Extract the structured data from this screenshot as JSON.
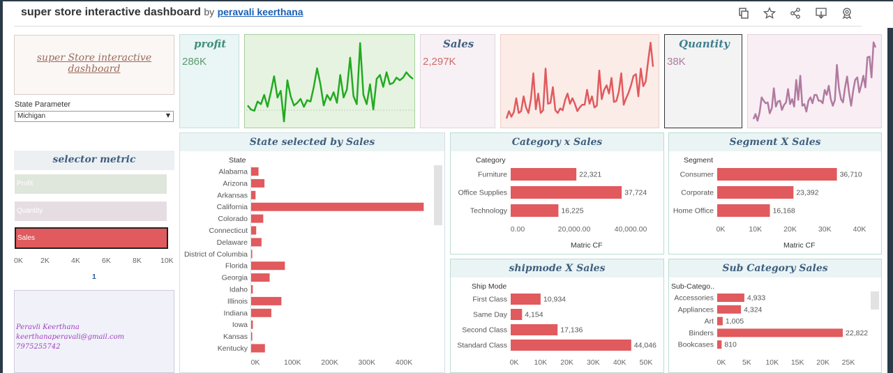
{
  "header": {
    "title": "super store interactive dashboard",
    "by": "by",
    "author": "peravali keerthana",
    "icons": [
      "revert-icon",
      "favorite-star-icon",
      "share-icon",
      "download-icon",
      "badge-icon"
    ]
  },
  "logo_text": [
    "super Store interactive",
    "dashboard"
  ],
  "state_param": {
    "label": "State Parameter",
    "value": "Michigan"
  },
  "selector": {
    "title": "selector metric",
    "items": [
      {
        "label": "Profit",
        "color": "#dfe6dc"
      },
      {
        "label": "Quantity",
        "color": "#e6dde2"
      },
      {
        "label": "Sales",
        "color": "#e05a5e"
      }
    ],
    "axis": [
      "0K",
      "2K",
      "4K",
      "6K",
      "8K",
      "10K"
    ],
    "page": "1"
  },
  "signature": {
    "name": "Peravli Keerthana",
    "email": "keerthanaperavali@gmail.com",
    "phone": "7975255742"
  },
  "kpis": {
    "profit": {
      "title": "profit",
      "value": "286K",
      "color": "#5a9a6e"
    },
    "sales": {
      "title": "Sales",
      "value": "2,297K",
      "color": "#d06a6a"
    },
    "quantity": {
      "title": "Quantity",
      "value": "38K",
      "color": "#b07aa0"
    }
  },
  "chart_data": [
    {
      "type": "line",
      "name": "profit sparkline",
      "color": "#22aa22",
      "values": [
        14,
        11,
        10,
        17,
        15,
        22,
        13,
        24,
        36,
        20,
        25,
        2,
        33,
        21,
        14,
        16,
        19,
        13,
        18,
        17,
        28,
        42,
        30,
        14,
        22,
        18,
        24,
        16,
        37,
        20,
        26,
        50,
        21,
        15,
        61,
        22,
        15,
        30,
        11,
        34,
        37,
        28,
        39,
        30,
        31,
        35,
        33,
        35,
        39,
        36,
        34
      ],
      "ylim": [
        0,
        64
      ]
    },
    {
      "type": "line",
      "name": "sales sparkline",
      "color": "#e05a5e",
      "values": [
        6,
        14,
        8,
        13,
        28,
        12,
        14,
        30,
        18,
        12,
        27,
        55,
        16,
        33,
        12,
        15,
        60,
        22,
        23,
        40,
        15,
        12,
        17,
        15,
        26,
        33,
        22,
        28,
        22,
        14,
        18,
        21,
        21,
        37,
        22,
        30,
        18,
        20,
        58,
        27,
        37,
        42,
        33,
        50,
        24,
        25,
        35,
        55,
        21,
        28,
        34,
        42,
        52,
        54,
        30,
        60,
        41,
        46,
        68,
        88,
        62
      ],
      "ylim": [
        0,
        92
      ]
    },
    {
      "type": "line",
      "name": "quantity sparkline",
      "color": "#b07aa0",
      "values": [
        6,
        12,
        4,
        14,
        32,
        28,
        25,
        26,
        13,
        19,
        43,
        21,
        27,
        28,
        17,
        23,
        26,
        42,
        24,
        30,
        21,
        53,
        29,
        58,
        22,
        24,
        15,
        28,
        32,
        25,
        35,
        35,
        28,
        28,
        25,
        41,
        35,
        46,
        30,
        22,
        29,
        71,
        43,
        30,
        26,
        44,
        57,
        37,
        22,
        40,
        53,
        56,
        38,
        47,
        58,
        44,
        80,
        81,
        56,
        98,
        92
      ],
      "ylim": [
        0,
        102
      ]
    },
    {
      "type": "bar",
      "title": "State selected by  Sales",
      "category_header": "State",
      "categories": [
        "Alabama",
        "Arizona",
        "Arkansas",
        "California",
        "Colorado",
        "Connecticut",
        "Delaware",
        "District of Columbia",
        "Florida",
        "Georgia",
        "Idaho",
        "Illinois",
        "Indiana",
        "Iowa",
        "Kansas",
        "Kentucky"
      ],
      "values": [
        19511,
        35282,
        11678,
        457688,
        32108,
        13384,
        27451,
        2865,
        89474,
        49096,
        4382,
        80166,
        53555,
        4580,
        2914,
        36592
      ],
      "xticks": [
        "0K",
        "100K",
        "200K",
        "300K",
        "400K"
      ],
      "xlim": [
        0,
        470000
      ],
      "color": "#e05a5e"
    },
    {
      "type": "bar",
      "title": "Category  x Sales",
      "category_header": "Category",
      "categories": [
        "Furniture",
        "Office Supplies",
        "Technology"
      ],
      "values": [
        22321,
        37724,
        16225
      ],
      "labels": [
        "22,321",
        "37,724",
        "16,225"
      ],
      "xticks": [
        "0.00",
        "20,000.00",
        "40,000.00"
      ],
      "xlim": [
        0,
        46000
      ],
      "xlabel": "Matric CF",
      "color": "#e05a5e"
    },
    {
      "type": "bar",
      "title": "Segment X Sales",
      "category_header": "Segment",
      "categories": [
        "Consumer",
        "Corporate",
        "Home Office"
      ],
      "values": [
        36710,
        23392,
        16168
      ],
      "labels": [
        "36,710",
        "23,392",
        "16,168"
      ],
      "xticks": [
        "0K",
        "10K",
        "20K",
        "30K",
        "40K"
      ],
      "xlim": [
        0,
        43000
      ],
      "xlabel": "Matric CF",
      "color": "#e05a5e"
    },
    {
      "type": "bar",
      "title": "shipmode X Sales",
      "category_header": "Ship Mode",
      "categories": [
        "First Class",
        "Same Day",
        "Second Class",
        "Standard Class"
      ],
      "values": [
        10934,
        4154,
        17136,
        44046
      ],
      "labels": [
        "10,934",
        "4,154",
        "17,136",
        "44,046"
      ],
      "xticks": [
        "0K",
        "10K",
        "20K",
        "30K",
        "40K",
        "50K"
      ],
      "xlim": [
        0,
        52000
      ],
      "color": "#e05a5e"
    },
    {
      "type": "bar",
      "title": "Sub Category Sales",
      "category_header": "Sub-Catego..",
      "categories": [
        "Accessories",
        "Appliances",
        "Art",
        "Binders",
        "Bookcases"
      ],
      "values": [
        4933,
        4324,
        1005,
        22822,
        810
      ],
      "labels": [
        "4,933",
        "4,324",
        "1,005",
        "22,822",
        "810"
      ],
      "xticks": [
        "0K",
        "5K",
        "10K",
        "15K",
        "20K",
        "25K"
      ],
      "xlim": [
        0,
        27000
      ],
      "color": "#e05a5e"
    }
  ]
}
